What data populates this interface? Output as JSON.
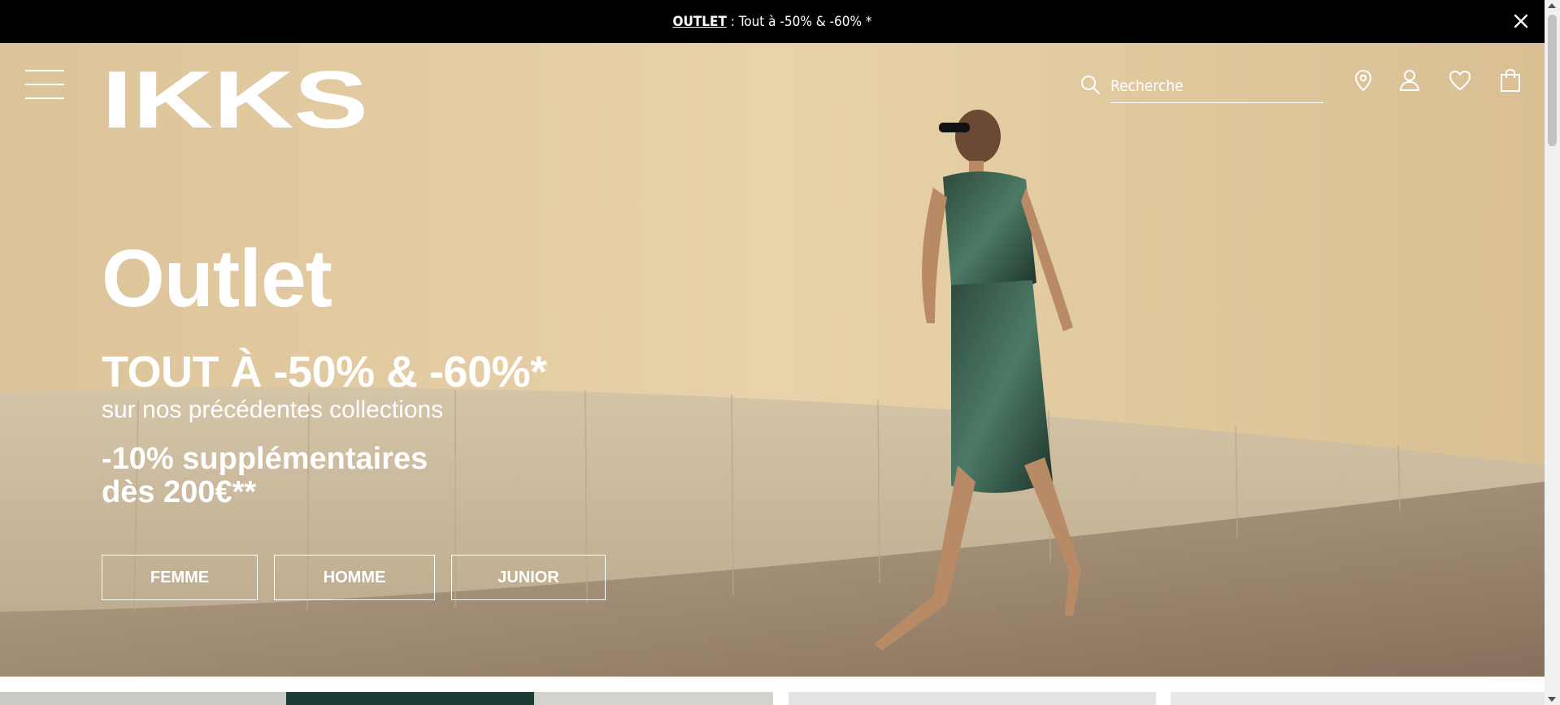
{
  "announcement": {
    "link_label": "OUTLET",
    "text": " : Tout à -50% & -60% *"
  },
  "header": {
    "logo_text": "IKKS",
    "search_placeholder": "Recherche",
    "icons": [
      "menu-icon",
      "search-icon",
      "store-locator-icon",
      "account-icon",
      "wishlist-icon",
      "bag-icon",
      "close-icon"
    ]
  },
  "hero": {
    "title": "Outlet",
    "headline": "TOUT À -50% & -60%*",
    "subline": "sur nos précédentes collections",
    "extra_offer": "-10% supplémentaires dès 200€**",
    "buttons": [
      {
        "label": "FEMME"
      },
      {
        "label": "HOMME"
      },
      {
        "label": "JUNIOR"
      }
    ]
  },
  "colors": {
    "topbar_bg": "#000000",
    "text_on_image": "#ffffff",
    "accent": "#ffffff"
  }
}
